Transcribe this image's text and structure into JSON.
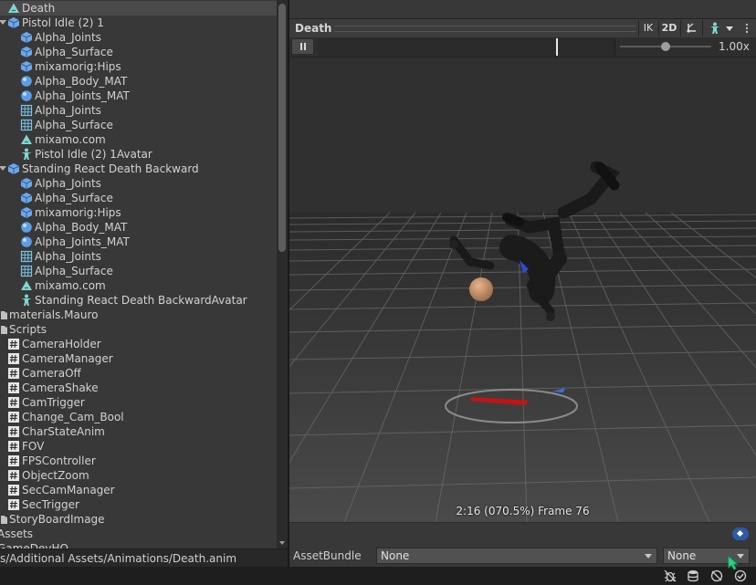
{
  "project_tree": {
    "items": [
      {
        "label": "Death",
        "icon": "animation-clip-icon",
        "indent": 0,
        "selected": true
      },
      {
        "label": "Pistol Idle (2) 1",
        "icon": "prefab-cube-icon",
        "indent": 0,
        "fold": true
      },
      {
        "label": "Alpha_Joints",
        "icon": "prefab-cube-icon",
        "indent": 1
      },
      {
        "label": "Alpha_Surface",
        "icon": "prefab-cube-icon",
        "indent": 1
      },
      {
        "label": "mixamorig:Hips",
        "icon": "prefab-cube-icon",
        "indent": 1
      },
      {
        "label": "Alpha_Body_MAT",
        "icon": "material-sphere-icon",
        "indent": 1
      },
      {
        "label": "Alpha_Joints_MAT",
        "icon": "material-sphere-icon",
        "indent": 1
      },
      {
        "label": "Alpha_Joints",
        "icon": "mesh-grid-icon",
        "indent": 1
      },
      {
        "label": "Alpha_Surface",
        "icon": "mesh-grid-icon",
        "indent": 1
      },
      {
        "label": "mixamo.com",
        "icon": "animation-clip-icon",
        "indent": 1
      },
      {
        "label": "Pistol Idle (2) 1Avatar",
        "icon": "avatar-figure-icon",
        "indent": 1
      },
      {
        "label": "Standing React Death Backward",
        "icon": "prefab-cube-icon",
        "indent": 0,
        "fold": true
      },
      {
        "label": "Alpha_Joints",
        "icon": "prefab-cube-icon",
        "indent": 1
      },
      {
        "label": "Alpha_Surface",
        "icon": "prefab-cube-icon",
        "indent": 1
      },
      {
        "label": "mixamorig:Hips",
        "icon": "prefab-cube-icon",
        "indent": 1
      },
      {
        "label": "Alpha_Body_MAT",
        "icon": "material-sphere-icon",
        "indent": 1
      },
      {
        "label": "Alpha_Joints_MAT",
        "icon": "material-sphere-icon",
        "indent": 1
      },
      {
        "label": "Alpha_Joints",
        "icon": "mesh-grid-icon",
        "indent": 1
      },
      {
        "label": "Alpha_Surface",
        "icon": "mesh-grid-icon",
        "indent": 1
      },
      {
        "label": "mixamo.com",
        "icon": "animation-clip-icon",
        "indent": 1
      },
      {
        "label": "Standing React Death BackwardAvatar",
        "icon": "avatar-figure-icon",
        "indent": 1
      },
      {
        "label": "materials.Mauro",
        "icon": "folder-icon",
        "indent": -1
      },
      {
        "label": "Scripts",
        "icon": "folder-icon",
        "indent": -1,
        "fold": true
      },
      {
        "label": "CameraHolder",
        "icon": "csharp-script-icon",
        "indent": 0
      },
      {
        "label": "CameraManager",
        "icon": "csharp-script-icon",
        "indent": 0
      },
      {
        "label": "CameraOff",
        "icon": "csharp-script-icon",
        "indent": 0
      },
      {
        "label": "CameraShake",
        "icon": "csharp-script-icon",
        "indent": 0
      },
      {
        "label": "CamTrigger",
        "icon": "csharp-script-icon",
        "indent": 0
      },
      {
        "label": "Change_Cam_Bool",
        "icon": "csharp-script-icon",
        "indent": 0
      },
      {
        "label": "CharStateAnim",
        "icon": "csharp-script-icon",
        "indent": 0
      },
      {
        "label": "FOV",
        "icon": "csharp-script-icon",
        "indent": 0
      },
      {
        "label": "FPSController",
        "icon": "csharp-script-icon",
        "indent": 0
      },
      {
        "label": "ObjectZoom",
        "icon": "csharp-script-icon",
        "indent": 0
      },
      {
        "label": "SecCamManager",
        "icon": "csharp-script-icon",
        "indent": 0
      },
      {
        "label": "SecTrigger",
        "icon": "csharp-script-icon",
        "indent": 0
      },
      {
        "label": "StoryBoardImage",
        "icon": "folder-icon",
        "indent": -1
      },
      {
        "label": "Assets",
        "icon": "none",
        "indent": -2
      },
      {
        "label": "GameDevHQ",
        "icon": "none",
        "indent": -2
      }
    ]
  },
  "path_bar": {
    "text": "s/Additional Assets/Animations/Death.anim"
  },
  "preview": {
    "title": "Death",
    "buttons": {
      "ik": "IK",
      "two_d": "2D"
    },
    "speed_label": "1.00x",
    "speed_value": 1.0,
    "playhead_fraction": 0.7,
    "status": "2:16 (070.5%) Frame 76"
  },
  "asset_bundle": {
    "label": "AssetBundle",
    "name_value": "None",
    "variant_value": "None"
  },
  "colors": {
    "panel": "#383838",
    "selection": "#4a4a4a",
    "text": "#d2d2d2",
    "accent_blue": "#2f5aa6",
    "icon_teal": "#7fd6d0"
  }
}
